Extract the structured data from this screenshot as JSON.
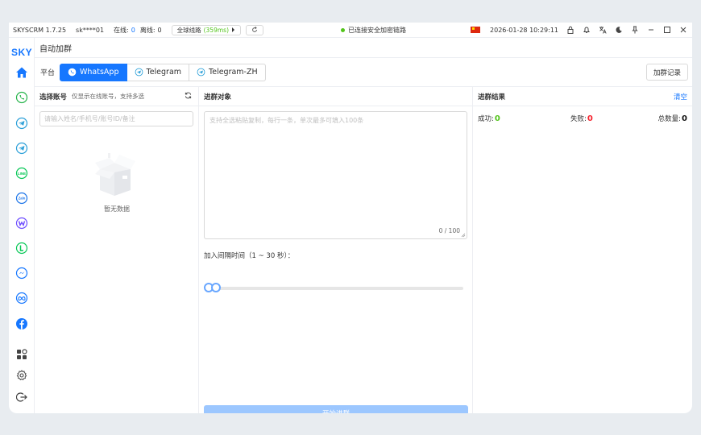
{
  "titlebar": {
    "app": "SKYSCRM 1.7.25",
    "user": "sk****01",
    "online_label": "在线:",
    "online_count": "0",
    "offline_label": "离线:",
    "offline_count": "0",
    "line_label": "全球线路",
    "line_ms": "(359ms)",
    "connection": "已连接安全加密链路",
    "datetime": "2026-01-28 10:29:11"
  },
  "sidebar": {
    "logo": "SKY"
  },
  "page": {
    "title": "自动加群"
  },
  "platform": {
    "label": "平台",
    "tabs": [
      {
        "label": "WhatsApp"
      },
      {
        "label": "Telegram"
      },
      {
        "label": "Telegram-ZH"
      }
    ],
    "record_button": "加群记录"
  },
  "accounts": {
    "title": "选择账号",
    "hint": "仅显示在线账号，支持多选",
    "search_placeholder": "请输入姓名/手机号/账号ID/备注",
    "empty": "暂无数据"
  },
  "targets": {
    "title": "进群对象",
    "placeholder": "支持全选粘贴复制，每行一条，单次最多可填入100条",
    "counter": "0 / 100",
    "interval_label": "加入间隔时间（1 ~ 30 秒）：",
    "start_button": "开始进群"
  },
  "results": {
    "title": "进群结果",
    "clear": "清空",
    "success_label": "成功:",
    "success_value": "0",
    "fail_label": "失败:",
    "fail_value": "0",
    "total_label": "总数量:",
    "total_value": "0"
  }
}
